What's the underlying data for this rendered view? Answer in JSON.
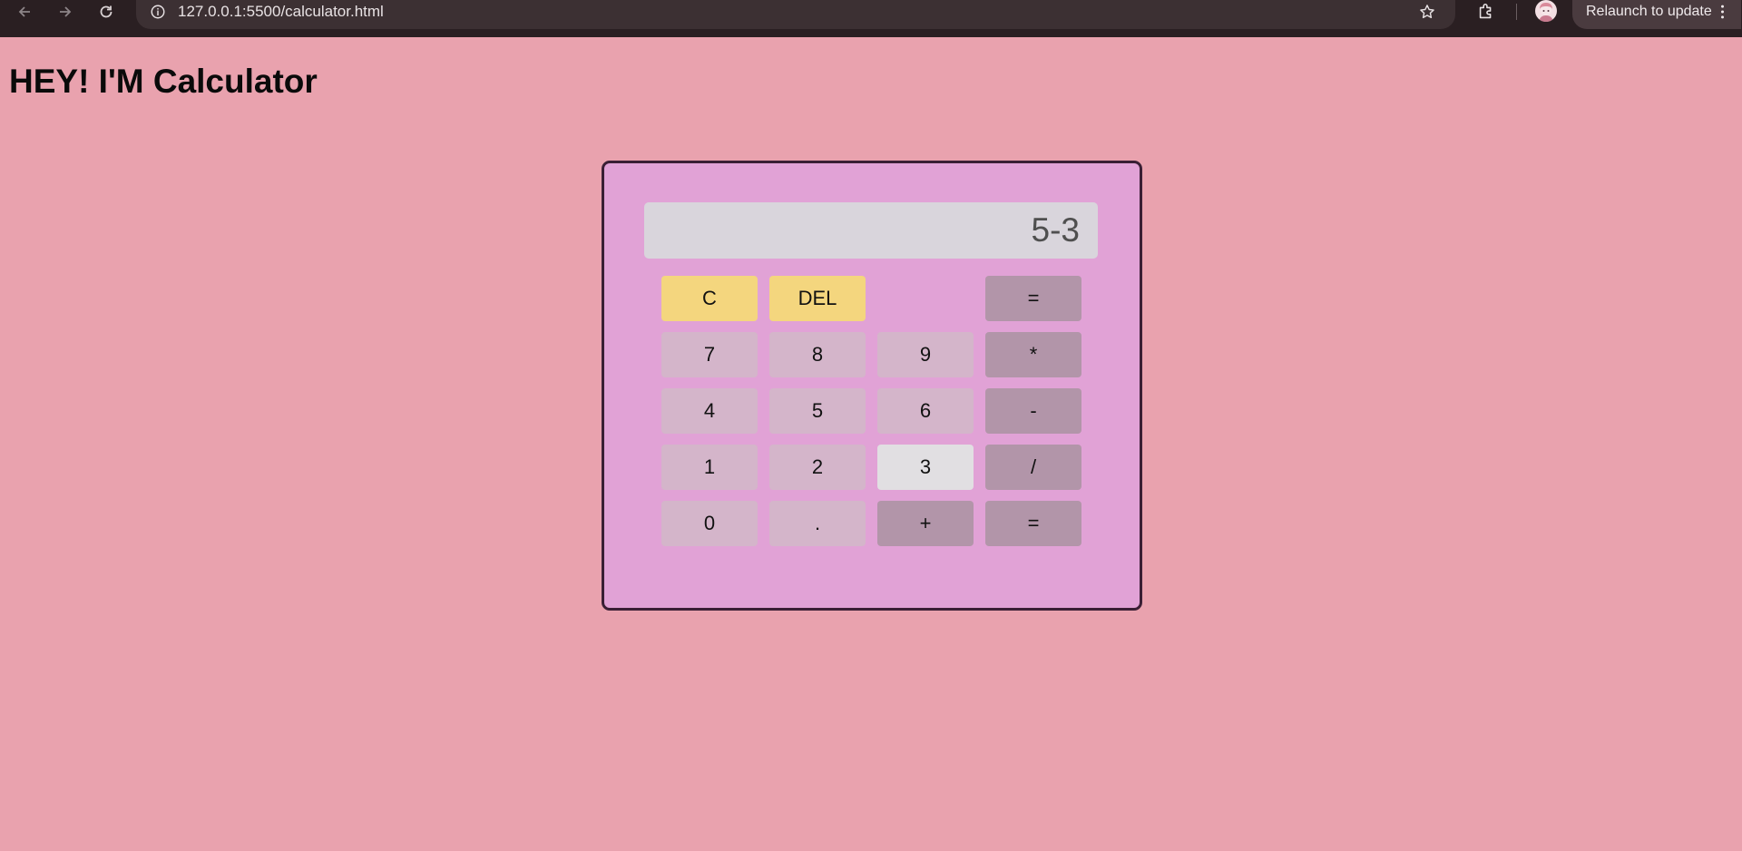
{
  "browser": {
    "url": "127.0.0.1:5500/calculator.html",
    "relaunch_label": "Relaunch to update",
    "icons": {
      "back": "arrow-left",
      "forward": "arrow-right",
      "reload": "reload",
      "site_info": "info-circle",
      "bookmark": "star-outline",
      "extensions": "puzzle-piece",
      "menu": "three-dots-vertical"
    }
  },
  "page": {
    "title": "HEY! I'M Calculator"
  },
  "calculator": {
    "display_value": "5-3",
    "colors": {
      "background": "#e1a2d6",
      "border": "#3a1f35",
      "display": "#d9d5dc",
      "digit_key": "#d4b5ca",
      "function_key": "#f4d67e",
      "operator_key": "#b295a9",
      "pressed_key": "#e1dfe2"
    },
    "keys": {
      "clear": "C",
      "delete": "DEL",
      "equals_top": "=",
      "seven": "7",
      "eight": "8",
      "nine": "9",
      "multiply": "*",
      "four": "4",
      "five": "5",
      "six": "6",
      "subtract": "-",
      "one": "1",
      "two": "2",
      "three": "3",
      "divide": "/",
      "zero": "0",
      "decimal": ".",
      "add": "+",
      "equals_bottom": "="
    }
  }
}
